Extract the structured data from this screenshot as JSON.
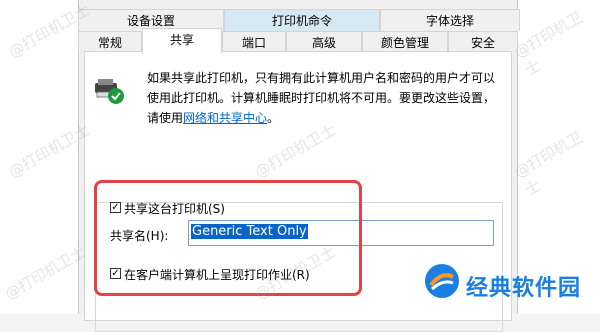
{
  "tabs_row1": [
    "设备设置",
    "打印机命令",
    "字体选择"
  ],
  "tabs_row2": [
    "常规",
    "共享",
    "端口",
    "高级",
    "颜色管理",
    "安全"
  ],
  "info": {
    "text": "如果共享此打印机，只有拥有此计算机用户名和密码的用户才可以使用此打印机。计算机睡眠时打印机将不可用。要更改这些设置，请使用",
    "link": "网络和共享中心",
    "tail": "。"
  },
  "share_checkbox": {
    "label": "共享这台打印机(S)",
    "checked": true
  },
  "share_name": {
    "label": "共享名(H):",
    "value": "Generic  Text Only"
  },
  "render_checkbox": {
    "label": "在客户端计算机上呈现打印作业(R)",
    "checked": true
  },
  "watermark": "@打印机卫士",
  "brand": {
    "name": "经典软件园",
    "color": "#1a7fe0"
  },
  "colors": {
    "highlight": "#e34343",
    "selection": "#0a64c8",
    "link": "#0066cc"
  }
}
